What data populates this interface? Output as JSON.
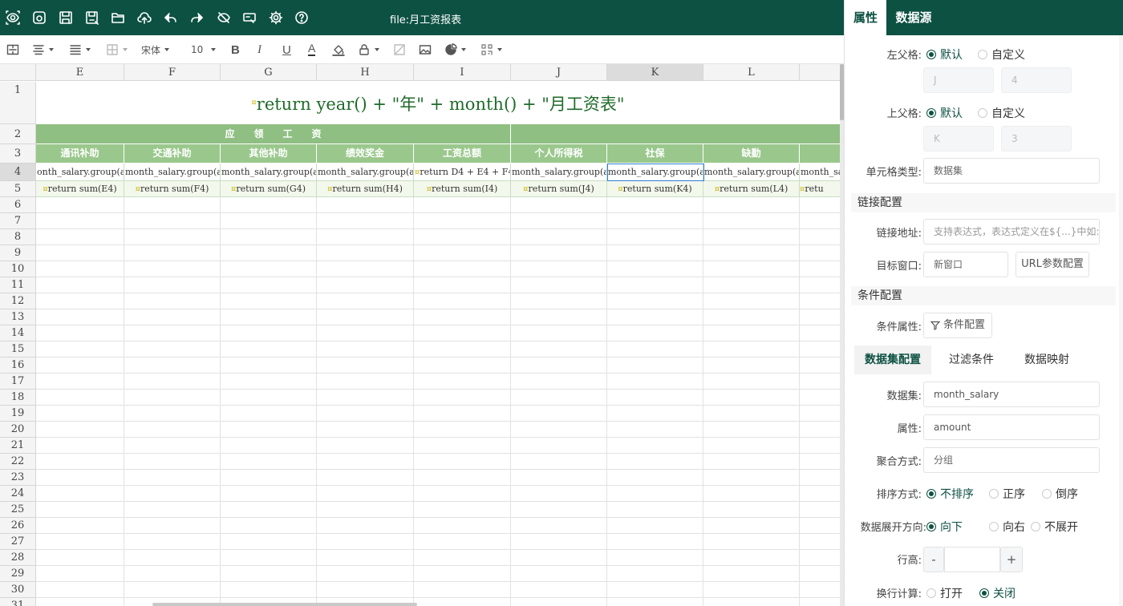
{
  "toolbar_top": {
    "file_title": "file:月工资报表",
    "icons": [
      "preview-icon",
      "view-icon",
      "save-icon",
      "save-as-icon",
      "open-folder-icon",
      "upload-icon",
      "undo-icon",
      "redo-icon",
      "hide-icon",
      "print-preview-icon",
      "settings-icon",
      "help-icon"
    ]
  },
  "format_toolbar": {
    "font_family": "宋体",
    "font_size": "10",
    "bold": "B",
    "italic": "I",
    "underline": "U",
    "font_color": "A"
  },
  "sheet": {
    "columns": [
      "E",
      "F",
      "G",
      "H",
      "I",
      "J",
      "K",
      "L"
    ],
    "selected_column": "K",
    "rows": [
      "1",
      "2",
      "3",
      "4",
      "5",
      "6",
      "7",
      "8",
      "9",
      "10",
      "11",
      "12",
      "13",
      "14",
      "15",
      "16",
      "17",
      "18",
      "19",
      "20",
      "21",
      "22",
      "23",
      "24",
      "25",
      "26",
      "27",
      "28",
      "29",
      "30",
      "31"
    ],
    "selected_row": "4",
    "title_formula": "return year() + \"年\" + month() + \"月工资表\"",
    "row2_group": "应　　领　　工　　资",
    "headers": [
      "通讯补助",
      "交通补助",
      "其他补助",
      "绩效奖金",
      "工资总额",
      "个人所得税",
      "社保",
      "缺勤",
      "其"
    ],
    "row4": [
      "onth_salary.group(a",
      "month_salary.group(a",
      "month_salary.group(a",
      "month_salary.group(a",
      "return D4 + E4 + F4",
      "month_salary.group(a",
      "month_salary.group(a",
      "month_salary.group(a",
      "month_sa"
    ],
    "row5": [
      "return sum(E4)",
      "return sum(F4)",
      "return sum(G4)",
      "return sum(H4)",
      "return sum(I4)",
      "return sum(J4)",
      "return sum(K4)",
      "return sum(L4)",
      "retu"
    ],
    "colors": {
      "header_bg": "#9ac88c",
      "group_bg": "#8fbf82",
      "title_text": "#1f6b2a",
      "marker": "#c8b400",
      "selection": "#2f7bd9"
    }
  },
  "panel": {
    "tabs": [
      "属性",
      "数据源"
    ],
    "active_tab": "属性",
    "left_parent": {
      "label": "左父格:",
      "opt1": "默认",
      "opt2": "自定义",
      "col": "J",
      "row": "4"
    },
    "top_parent": {
      "label": "上父格:",
      "opt1": "默认",
      "opt2": "自定义",
      "col": "K",
      "row": "3"
    },
    "cell_type": {
      "label": "单元格类型:",
      "value": "数据集"
    },
    "link_section": "链接配置",
    "link_url": {
      "label": "链接地址:",
      "placeholder": "支持表达式，表达式定义在${...}中如:"
    },
    "target_window": {
      "label": "目标窗口:",
      "value": "新窗口",
      "button": "URL参数配置"
    },
    "condition_section": "条件配置",
    "condition_attr": {
      "label": "条件属性:",
      "button": "条件配置"
    },
    "subtabs": [
      "数据集配置",
      "过滤条件",
      "数据映射"
    ],
    "active_subtab": "数据集配置",
    "dataset": {
      "label": "数据集:",
      "value": "month_salary"
    },
    "attribute": {
      "label": "属性:",
      "value": "amount"
    },
    "aggregate": {
      "label": "聚合方式:",
      "value": "分组"
    },
    "sort": {
      "label": "排序方式:",
      "options": [
        "不排序",
        "正序",
        "倒序"
      ],
      "selected": "不排序"
    },
    "expand": {
      "label": "数据展开方向:",
      "options": [
        "向下",
        "向右",
        "不展开"
      ],
      "selected": "向下"
    },
    "row_height": {
      "label": "行高:",
      "minus": "-",
      "value": "",
      "plus": "+"
    },
    "line_calc": {
      "label": "换行计算:",
      "options": [
        "打开",
        "关闭"
      ],
      "selected": "关闭"
    },
    "accent": "#0d5143"
  }
}
